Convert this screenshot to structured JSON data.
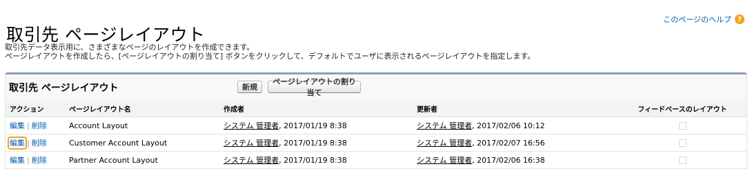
{
  "header": {
    "title": "取引先 ページレイアウト",
    "help_link": "このページのヘルプ",
    "help_icon": "question-icon"
  },
  "description": {
    "line1": "取引先データ表示用に、さまざまなページのレイアウトを作成できます。",
    "line2": "ページレイアウトを作成したら、[ページレイアウトの割り当て] ボタンをクリックして、デフォルトでユーザに表示されるページレイアウトを指定します。"
  },
  "panel": {
    "title": "取引先 ページレイアウト",
    "new_button": "新規",
    "assign_button": "ページレイアウトの割り当て"
  },
  "table": {
    "headers": [
      "アクション",
      "ページレイアウト名",
      "作成者",
      "更新者",
      "フィードベースのレイアウト"
    ],
    "edit_label": "編集",
    "delete_label": "削除",
    "separator": "|",
    "rows": [
      {
        "name": "Account Layout",
        "created_by": "システム 管理者",
        "created_at": ", 2017/01/19 8:38",
        "modified_by": "システム 管理者",
        "modified_at": ", 2017/02/06 10:12",
        "feed_based": false
      },
      {
        "name": "Customer Account Layout",
        "created_by": "システム 管理者",
        "created_at": ", 2017/01/19 8:38",
        "modified_by": "システム 管理者",
        "modified_at": ", 2017/02/07 16:56",
        "feed_based": false
      },
      {
        "name": "Partner Account Layout",
        "created_by": "システム 管理者",
        "created_at": ", 2017/01/19 8:38",
        "modified_by": "システム 管理者",
        "modified_at": ", 2017/02/06 16:38",
        "feed_based": false
      }
    ]
  },
  "colors": {
    "link": "#015ba7",
    "panel_border": "#8a9ebe",
    "highlight": "#f0a030"
  }
}
